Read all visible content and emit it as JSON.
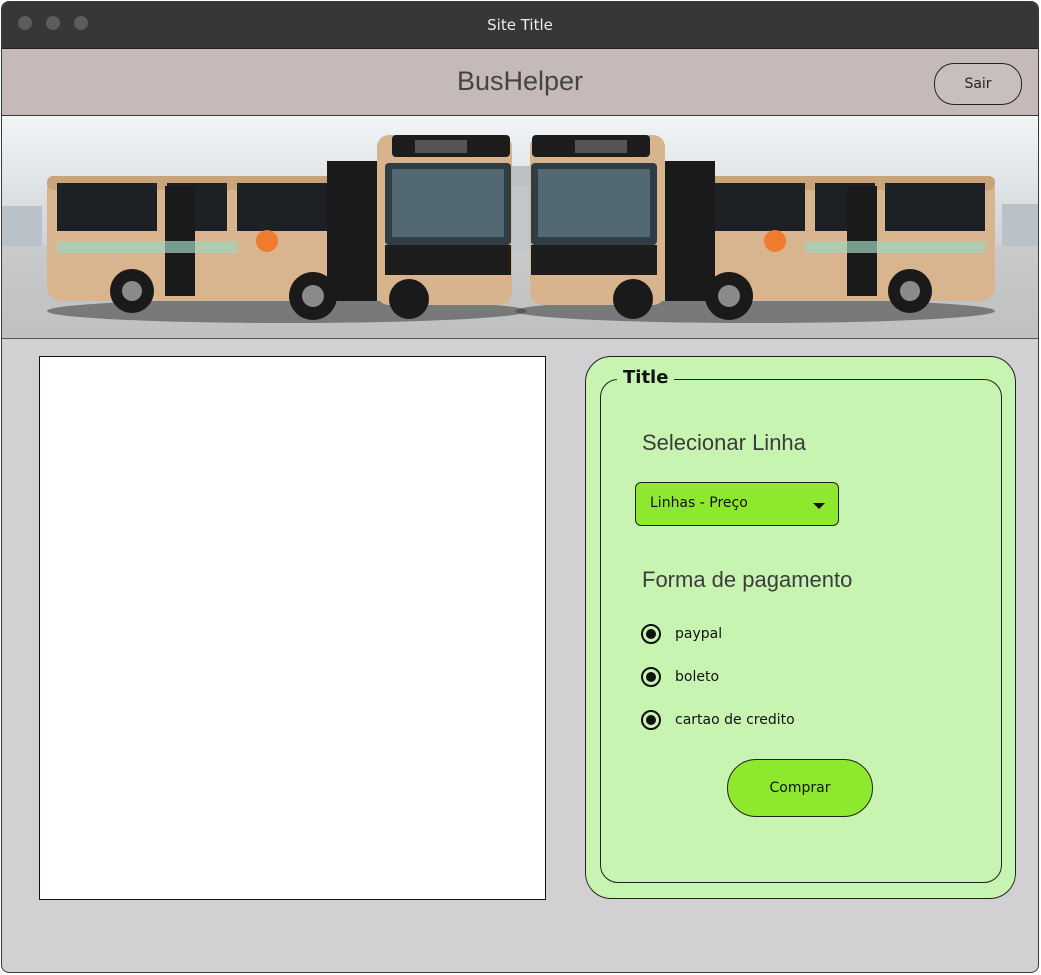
{
  "window": {
    "title": "Site Title"
  },
  "header": {
    "brand": "BusHelper",
    "logout_label": "Sair"
  },
  "banner": {
    "image_name": "bus-banner-image"
  },
  "panel": {
    "legend": "Title",
    "line_heading": "Selecionar Linha",
    "line_select": {
      "selected": "Linhas - Preço"
    },
    "payment_heading": "Forma de pagamento",
    "payment_options": [
      "paypal",
      "boleto",
      "cartao de credito"
    ],
    "buy_label": "Comprar"
  },
  "colors": {
    "accent": "#8ee82e",
    "panel_bg": "#c8f4b2",
    "header_bg": "#c5b9b9",
    "bus_body": "#d9b58f"
  }
}
